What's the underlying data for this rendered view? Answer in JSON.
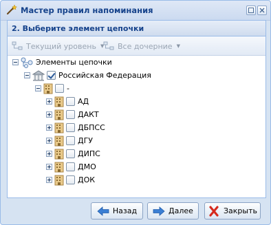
{
  "window": {
    "title": "Мастер правил напоминания",
    "title_icon": "wand-icon",
    "buttons": [
      "restore-icon",
      "close-icon"
    ]
  },
  "panel": {
    "title": "2. Выберите элемент цепочки"
  },
  "toolbar": {
    "current_level_label": "Текущий уровень",
    "all_children_label": "Все дочерние"
  },
  "tree": {
    "root_label": "Элементы цепочки",
    "country_label": "Российская Федерация",
    "country_checked": true,
    "group_label": "-",
    "items": [
      {
        "label": "АД"
      },
      {
        "label": "ДАКТ"
      },
      {
        "label": "ДБПСС"
      },
      {
        "label": "ДГУ"
      },
      {
        "label": "ДИПС"
      },
      {
        "label": "ДМО"
      },
      {
        "label": "ДОК"
      }
    ]
  },
  "footer": {
    "back_label": "Назад",
    "next_label": "Далее",
    "close_label": "Закрыть"
  },
  "colors": {
    "accent": "#15428b",
    "border": "#99bbe8",
    "back_arrow": "#3b7fd4",
    "close_x": "#d62b1e"
  }
}
